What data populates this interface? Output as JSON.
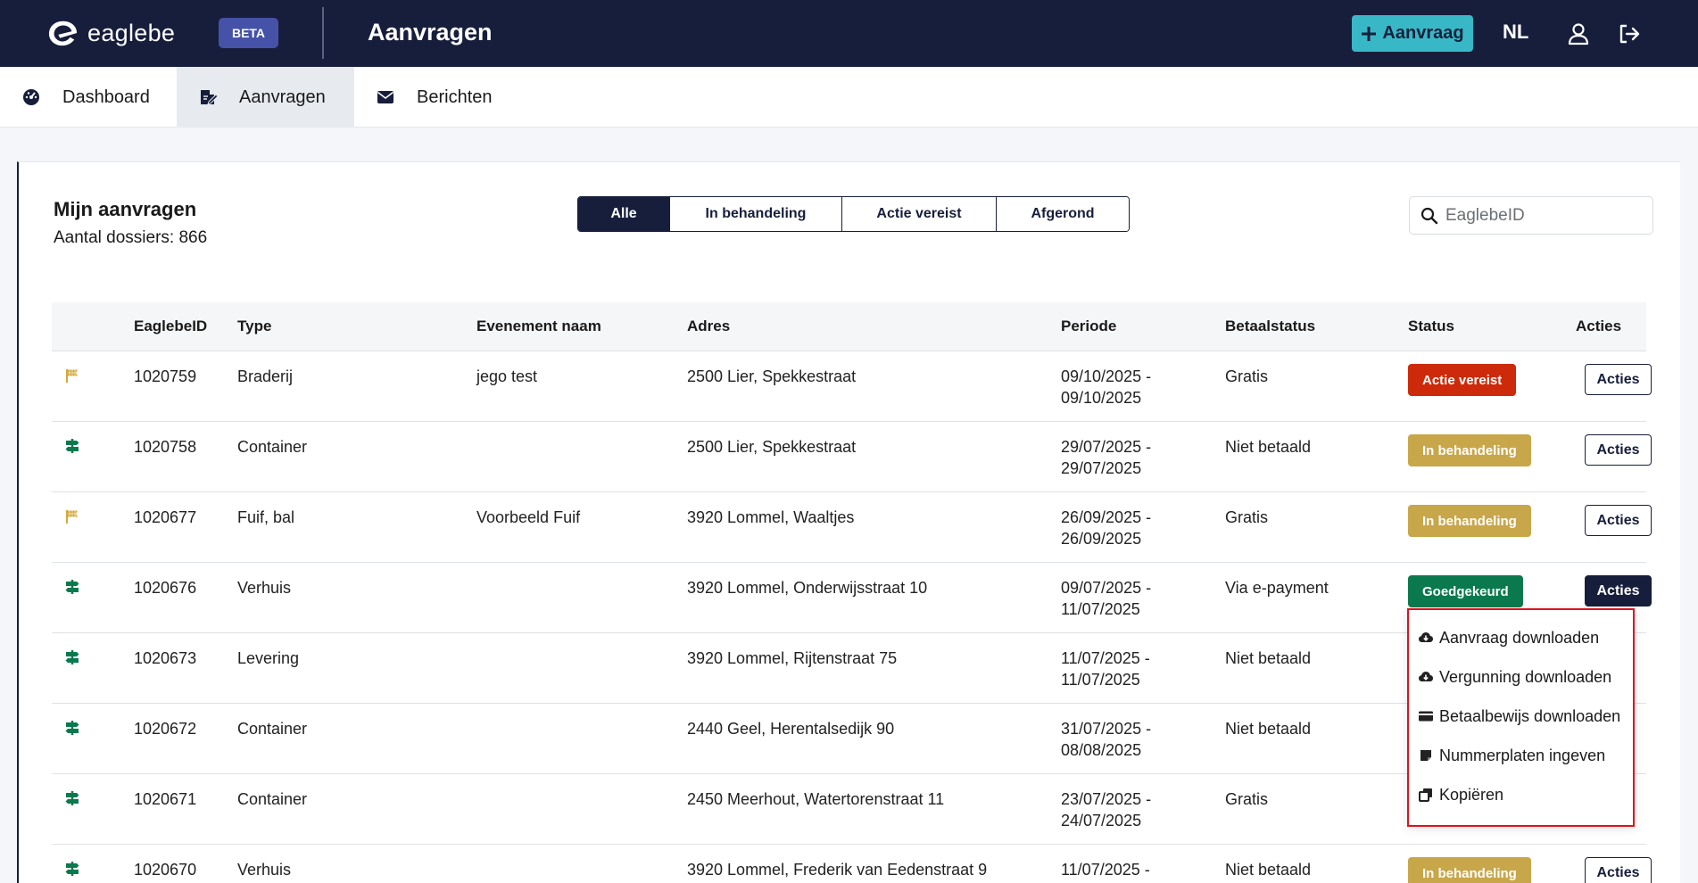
{
  "header": {
    "logo_text": "eaglebe",
    "beta_label": "BETA",
    "title": "Aanvragen",
    "new_button_label": "Aanvraag",
    "language": "NL",
    "icons": [
      "plus-icon",
      "user-icon",
      "logout-icon"
    ]
  },
  "nav": {
    "items": [
      {
        "label": "Dashboard",
        "icon": "dashboard-gauge-icon",
        "active": false
      },
      {
        "label": "Aanvragen",
        "icon": "edit-document-icon",
        "active": true
      },
      {
        "label": "Berichten",
        "icon": "envelope-icon",
        "active": false
      }
    ]
  },
  "main": {
    "title": "Mijn aanvragen",
    "subtitle": "Aantal dossiers: 866",
    "filters": [
      {
        "label": "Alle",
        "active": true
      },
      {
        "label": "In behandeling",
        "active": false
      },
      {
        "label": "Actie vereist",
        "active": false
      },
      {
        "label": "Afgerond",
        "active": false
      }
    ],
    "search_placeholder": "EaglebeID"
  },
  "table": {
    "columns": [
      "",
      "EaglebeID",
      "Type",
      "Evenement naam",
      "Adres",
      "Periode",
      "Betaalstatus",
      "Status",
      "Acties"
    ],
    "rows": [
      {
        "icon": "flag-icon",
        "icon_color": "#d4a93c",
        "id": "1020759",
        "type": "Braderij",
        "event": "jego test",
        "address": "2500 Lier, Spekkestraat",
        "period_start": "09/10/2025 -",
        "period_end": "09/10/2025",
        "payment": "Gratis",
        "status": "Actie vereist",
        "status_color": "#cc2a0a",
        "action_label": "Acties"
      },
      {
        "icon": "signpost-icon",
        "icon_color": "#0a7a4e",
        "id": "1020758",
        "type": "Container",
        "event": "",
        "address": "2500 Lier, Spekkestraat",
        "period_start": "29/07/2025 -",
        "period_end": "29/07/2025",
        "payment": "Niet betaald",
        "status": "In behandeling",
        "status_color": "#c8a64a",
        "action_label": "Acties"
      },
      {
        "icon": "flag-icon",
        "icon_color": "#d4a93c",
        "id": "1020677",
        "type": "Fuif, bal",
        "event": "Voorbeeld Fuif",
        "address": "3920 Lommel, Waaltjes",
        "period_start": "26/09/2025 -",
        "period_end": "26/09/2025",
        "payment": "Gratis",
        "status": "In behandeling",
        "status_color": "#c8a64a",
        "action_label": "Acties"
      },
      {
        "icon": "signpost-icon",
        "icon_color": "#0a7a4e",
        "id": "1020676",
        "type": "Verhuis",
        "event": "",
        "address": "3920 Lommel, Onderwijsstraat 10",
        "period_start": "09/07/2025 -",
        "period_end": "11/07/2025",
        "payment": "Via e-payment",
        "status": "Goedgekeurd",
        "status_color": "#0a7a4e",
        "action_label": "Acties"
      },
      {
        "icon": "signpost-icon",
        "icon_color": "#0a7a4e",
        "id": "1020673",
        "type": "Levering",
        "event": "",
        "address": "3920 Lommel, Rijtenstraat 75",
        "period_start": "11/07/2025 -",
        "period_end": "11/07/2025",
        "payment": "Niet betaald",
        "status": "",
        "status_color": "",
        "action_label": ""
      },
      {
        "icon": "signpost-icon",
        "icon_color": "#0a7a4e",
        "id": "1020672",
        "type": "Container",
        "event": "",
        "address": "2440 Geel, Herentalsedijk 90",
        "period_start": "31/07/2025 -",
        "period_end": "08/08/2025",
        "payment": "Niet betaald",
        "status": "",
        "status_color": "",
        "action_label": ""
      },
      {
        "icon": "signpost-icon",
        "icon_color": "#0a7a4e",
        "id": "1020671",
        "type": "Container",
        "event": "",
        "address": "2450 Meerhout, Watertorenstraat 11",
        "period_start": "23/07/2025 -",
        "period_end": "24/07/2025",
        "payment": "Gratis",
        "status": "",
        "status_color": "",
        "action_label": ""
      },
      {
        "icon": "signpost-icon",
        "icon_color": "#0a7a4e",
        "id": "1020670",
        "type": "Verhuis",
        "event": "",
        "address": "3920 Lommel, Frederik van Eedenstraat 9",
        "period_start": "11/07/2025 -",
        "period_end": "",
        "payment": "Niet betaald",
        "status": "In behandeling",
        "status_color": "#c8a64a",
        "action_label": "Acties"
      }
    ]
  },
  "dropdown": {
    "items": [
      {
        "label": "Aanvraag downloaden",
        "icon": "cloud-download-icon"
      },
      {
        "label": "Vergunning downloaden",
        "icon": "cloud-download-icon"
      },
      {
        "label": "Betaalbewijs downloaden",
        "icon": "credit-card-icon"
      },
      {
        "label": "Nummerplaten ingeven",
        "icon": "note-icon"
      },
      {
        "label": "Kopiëren",
        "icon": "copy-icon"
      }
    ],
    "highlight_color": "#e0111b"
  },
  "colors": {
    "navy": "#171e3b",
    "accent_teal": "#38b7c7",
    "beta_badge": "#4552a8"
  }
}
